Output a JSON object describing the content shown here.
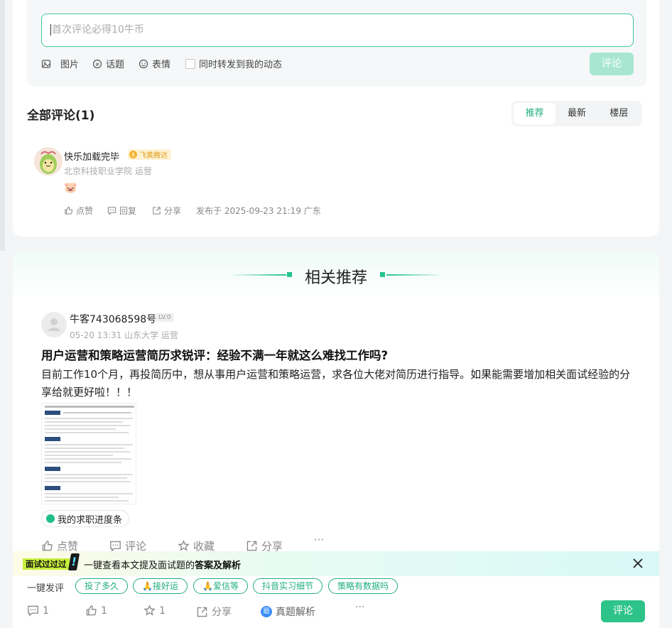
{
  "composer": {
    "placeholder": "首次评论必得10牛币",
    "tools": {
      "image": "图片",
      "topic": "话题",
      "emoji": "表情",
      "forward": "同时转发到我的动态"
    },
    "submit_label": "评论"
  },
  "comments": {
    "title": "全部评论(1)",
    "sort_tabs": [
      "推荐",
      "最新",
      "楼层"
    ],
    "items": [
      {
        "username": "快乐加载完毕",
        "badge": "飞黄腾达",
        "subtitle": "北京科技职业学院 运营",
        "content": "🐷",
        "actions": {
          "like": "点赞",
          "reply": "回复",
          "share": "分享"
        },
        "published": "发布于 2025-09-23 21:19 广东"
      }
    ]
  },
  "recommend": {
    "title": "相关推荐",
    "post": {
      "username": "牛客743068598号",
      "level": "LV.0",
      "meta": "05-20 13:31   山东大学 运营",
      "title": "用户运营和策略运营简历求锐评：经验不满一年就这么难找工作吗?",
      "body": "目前工作10个月，再投简历中，想从事用户运营和策略运营，求各位大佬对简历进行指导。如果能需要增加相关面试经验的分享给就更好啦！！！",
      "tag": "我的求职进度条",
      "actions": {
        "like": "点赞",
        "comment": "评论",
        "collect": "收藏",
        "share": "分享"
      }
    }
  },
  "banner": {
    "badge": "面试过过过",
    "mark": "!",
    "text_prefix": "一键查看本文提及面试题的",
    "text_highlight": "答案及解析"
  },
  "quick_reply": {
    "label": "一键发评",
    "chips": [
      "投了多久",
      "🙏接好运",
      "🙏爱信等",
      "抖音实习细节",
      "策略有数据吗"
    ]
  },
  "bottom_bar": {
    "comments": "1",
    "likes": "1",
    "stars": "1",
    "share": "分享",
    "zhenti_icon": "题",
    "zhenti": "真题解析",
    "more": "···",
    "comment_button": "评论"
  },
  "colors": {
    "accent": "#1fae83",
    "button": "#2dc389",
    "button_disabled": "#a8e6d1"
  }
}
